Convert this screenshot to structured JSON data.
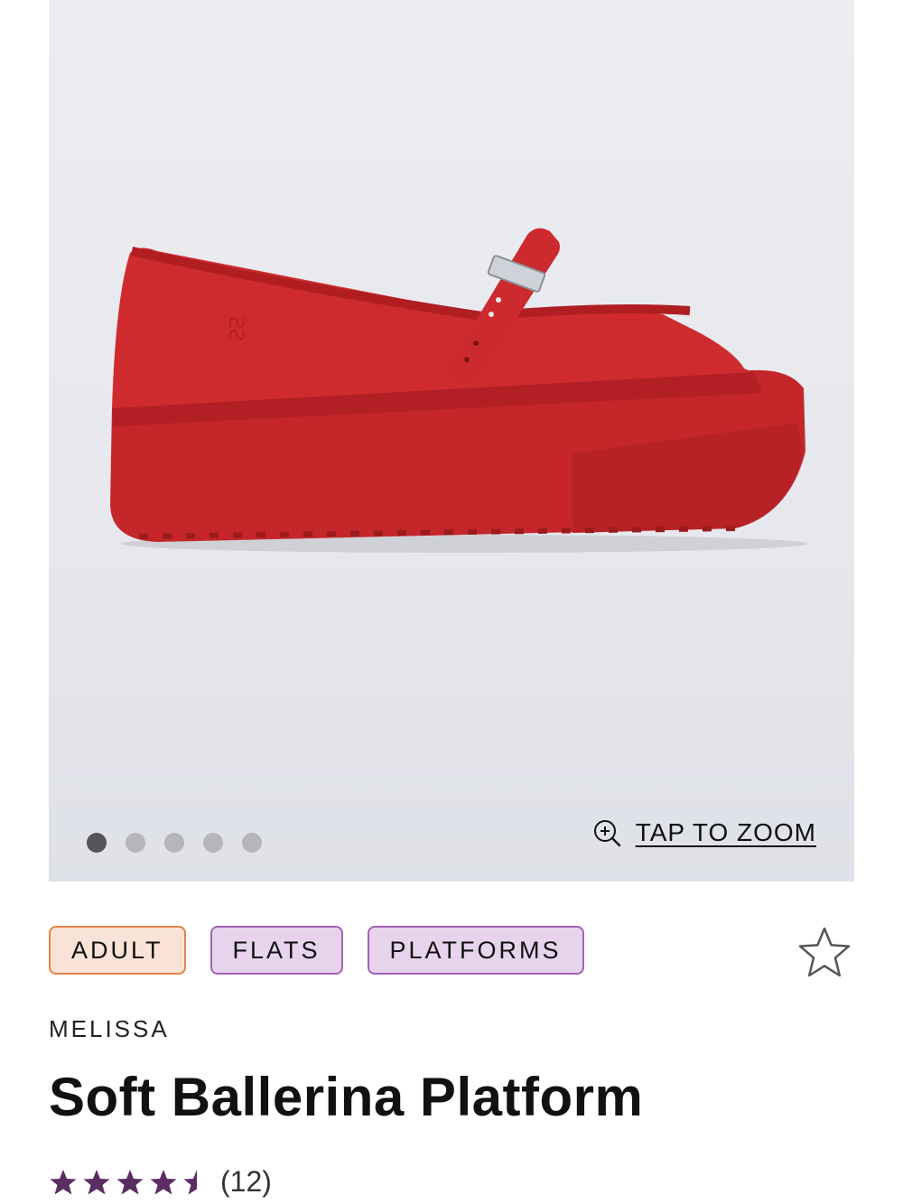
{
  "gallery": {
    "dots": [
      true,
      false,
      false,
      false,
      false
    ],
    "zoom_label": "TAP TO ZOOM",
    "zoom_icon": "zoom-in-icon"
  },
  "tags": [
    {
      "label": "ADULT",
      "color": "#f9e3d6",
      "border": "#e6824a"
    },
    {
      "label": "FLATS",
      "color": "#e7d3ec",
      "border": "#a063b4"
    },
    {
      "label": "PLATFORMS",
      "color": "#e7d3ec",
      "border": "#a063b4"
    }
  ],
  "favorite_icon": "star-outline-icon",
  "product": {
    "brand": "MELISSA",
    "title": "Soft Ballerina Platform",
    "rating": 4.5,
    "review_count": "(12)",
    "shoe_color": "#c8262b",
    "star_color": "#5a2e63"
  }
}
